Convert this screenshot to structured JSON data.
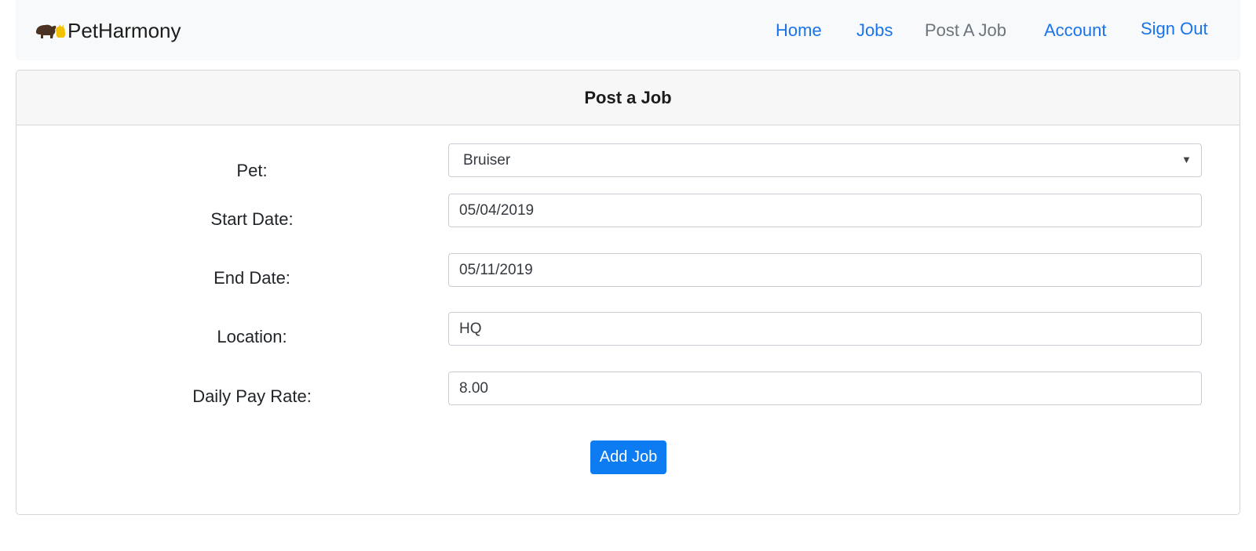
{
  "navbar": {
    "brand_name": "PetHarmony",
    "logo_icon": "bear-and-cat-logo-icon",
    "links": {
      "home": "Home",
      "jobs": "Jobs",
      "post_a_job": "Post A Job",
      "account": "Account",
      "sign_out": "Sign Out"
    },
    "active_link": "post_a_job",
    "link_color": "#1a73e8",
    "active_color": "#6c757d"
  },
  "card": {
    "title": "Post a Job"
  },
  "form": {
    "pet": {
      "label": "Pet:",
      "selected": "Bruiser",
      "arrow_icon": "caret-down-icon"
    },
    "start_date": {
      "label": "Start Date:",
      "value": "05/04/2019"
    },
    "end_date": {
      "label": "End Date:",
      "value": "05/11/2019"
    },
    "location": {
      "label": "Location:",
      "value": "HQ"
    },
    "daily_pay_rate": {
      "label": "Daily Pay Rate:",
      "value": "8.00"
    },
    "submit_label": "Add Job",
    "submit_color": "#0d7cf2"
  }
}
